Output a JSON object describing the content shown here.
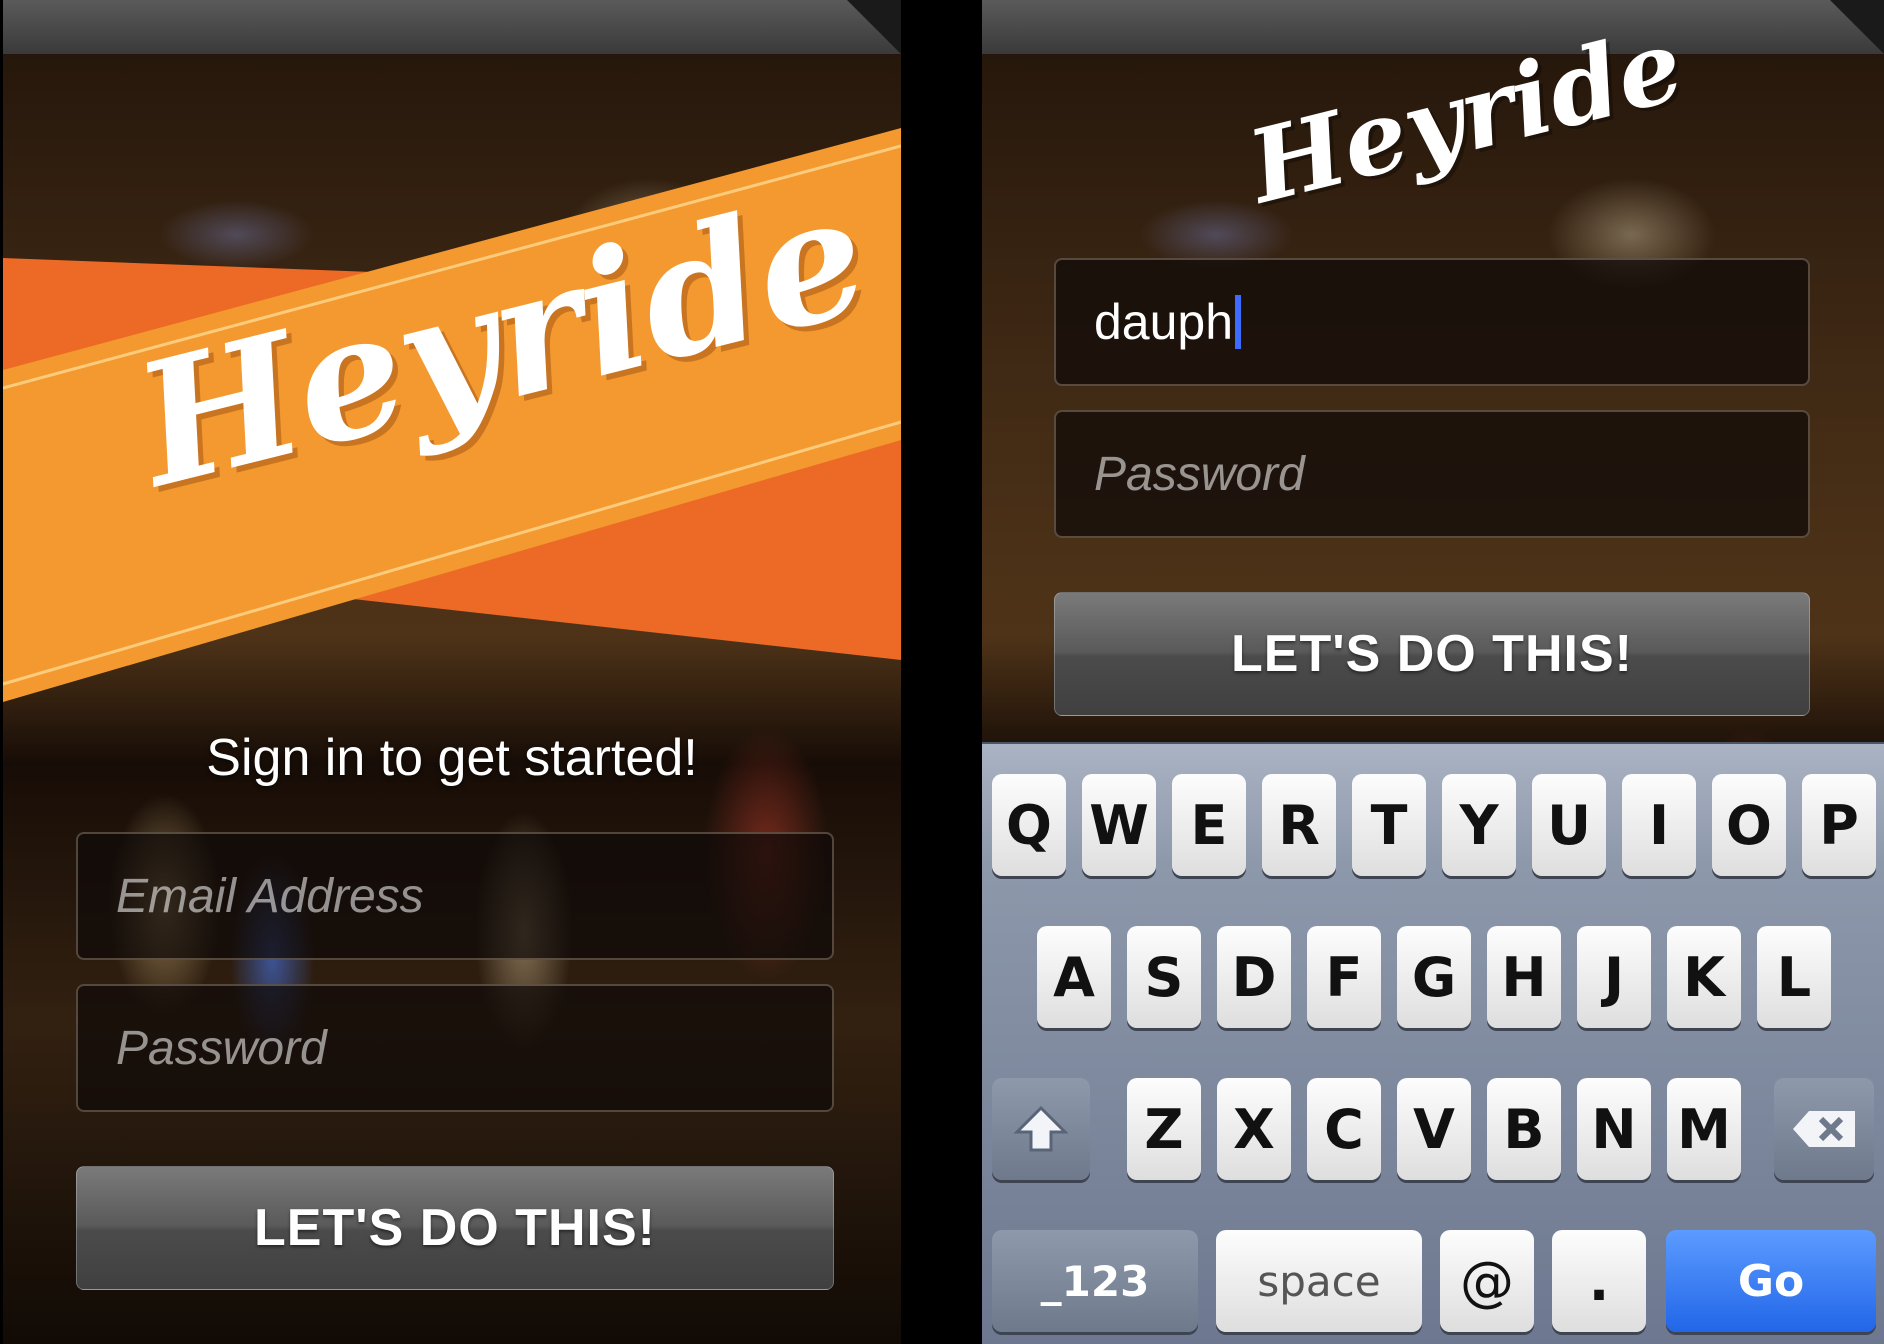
{
  "left_screen": {
    "logo": "Heyride",
    "tagline": "Sign in to get started!",
    "email_field": {
      "placeholder": "Email Address"
    },
    "password_field": {
      "placeholder": "Password"
    },
    "submit_label": "LET'S DO THIS!"
  },
  "right_screen": {
    "logo": "Heyride",
    "email_field": {
      "value": "dauph"
    },
    "password_field": {
      "placeholder": "Password"
    },
    "submit_label": "LET'S DO THIS!",
    "keyboard": {
      "row1": [
        "Q",
        "W",
        "E",
        "R",
        "T",
        "Y",
        "U",
        "I",
        "O",
        "P"
      ],
      "row2": [
        "A",
        "S",
        "D",
        "F",
        "G",
        "H",
        "J",
        "K",
        "L"
      ],
      "row3": [
        "Z",
        "X",
        "C",
        "V",
        "B",
        "N",
        "M"
      ],
      "numbers_label": "_123",
      "space_label": "space",
      "at_label": "@",
      "dot_label": ".",
      "go_label": "Go"
    }
  },
  "colors": {
    "banner_orange": "#f07a2a",
    "banner_light": "#f6a23a",
    "go_blue": "#2a6ff0",
    "caret_blue": "#3b6cff"
  },
  "icons": [
    "shift-icon",
    "backspace-icon"
  ]
}
